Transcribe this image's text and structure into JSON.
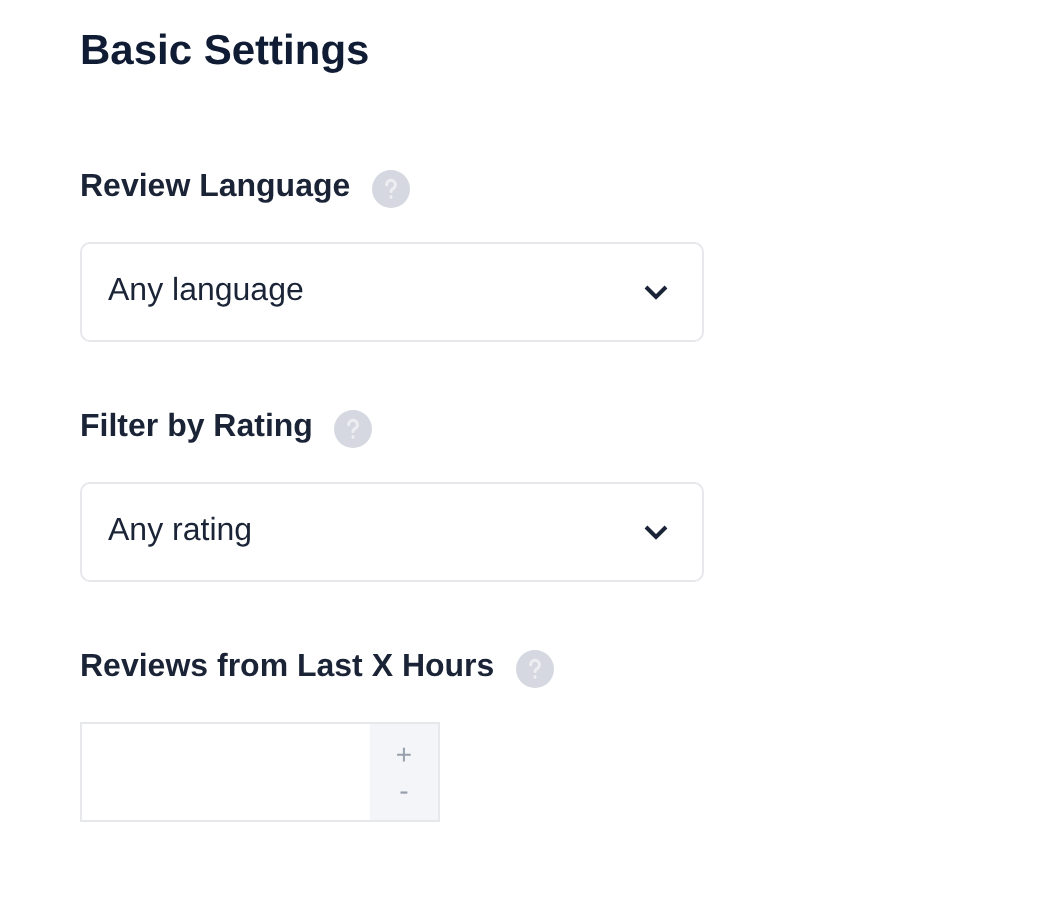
{
  "title": "Basic Settings",
  "fields": [
    {
      "kind": "select",
      "label": "Review Language",
      "value": "Any language"
    },
    {
      "kind": "select",
      "label": "Filter by Rating",
      "value": "Any rating"
    },
    {
      "kind": "number",
      "label": "Reviews from Last X Hours",
      "increment": "+",
      "decrement": "-"
    }
  ]
}
